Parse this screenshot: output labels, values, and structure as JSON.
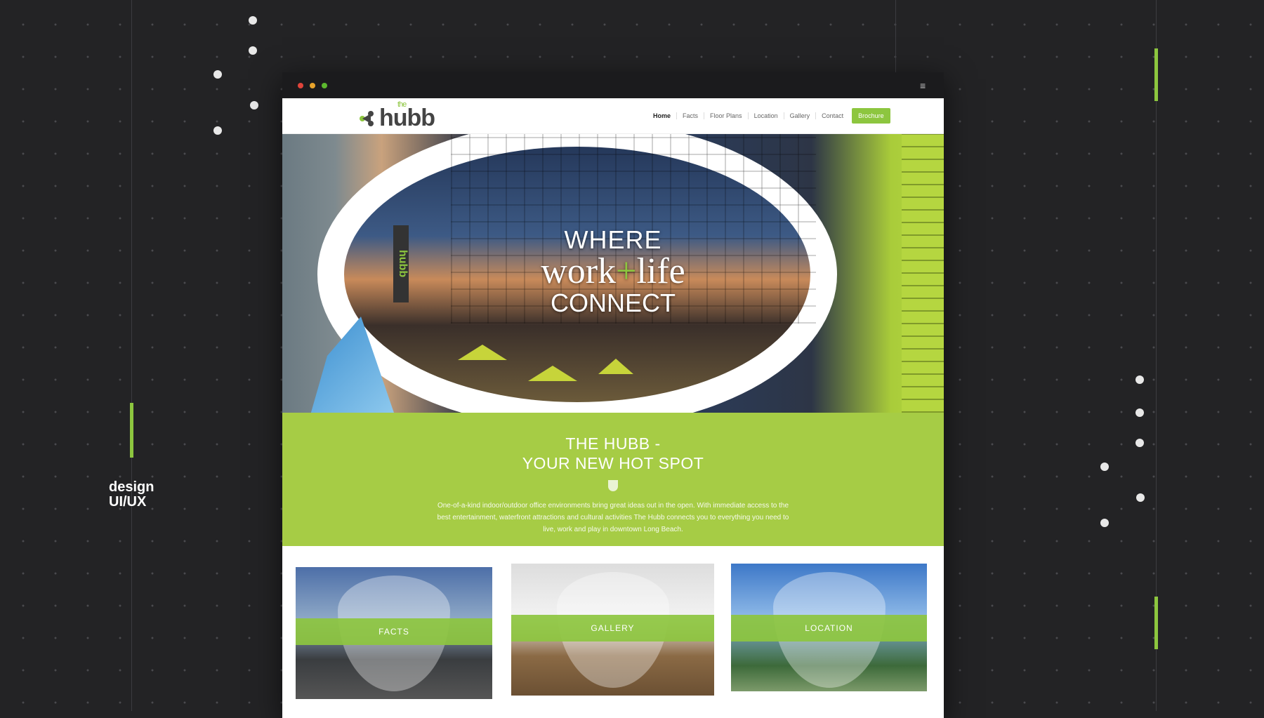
{
  "tagline": {
    "line1": "design",
    "line2": "UI/UX"
  },
  "site": {
    "logo": {
      "the": "the",
      "word": "hubb"
    },
    "nav": [
      "Home",
      "Facts",
      "Floor Plans",
      "Location",
      "Gallery",
      "Contact"
    ],
    "cta": "Brochure",
    "hero": {
      "line1": "WHERE",
      "work": "work",
      "plus": "+",
      "life": "life",
      "line3": "CONNECT",
      "sign": "hubb"
    },
    "intro": {
      "title1": "THE HUBB -",
      "title2": "YOUR NEW HOT SPOT",
      "body": "One-of-a-kind indoor/outdoor office environments bring great ideas out in the open. With immediate access to the best entertainment, waterfront attractions and cultural activities The Hubb connects you to everything you need to live, work and play in downtown Long Beach."
    },
    "cards": [
      "FACTS",
      "GALLERY",
      "LOCATION"
    ]
  },
  "colors": {
    "accent": "#8dc63f",
    "background": "#232325"
  }
}
